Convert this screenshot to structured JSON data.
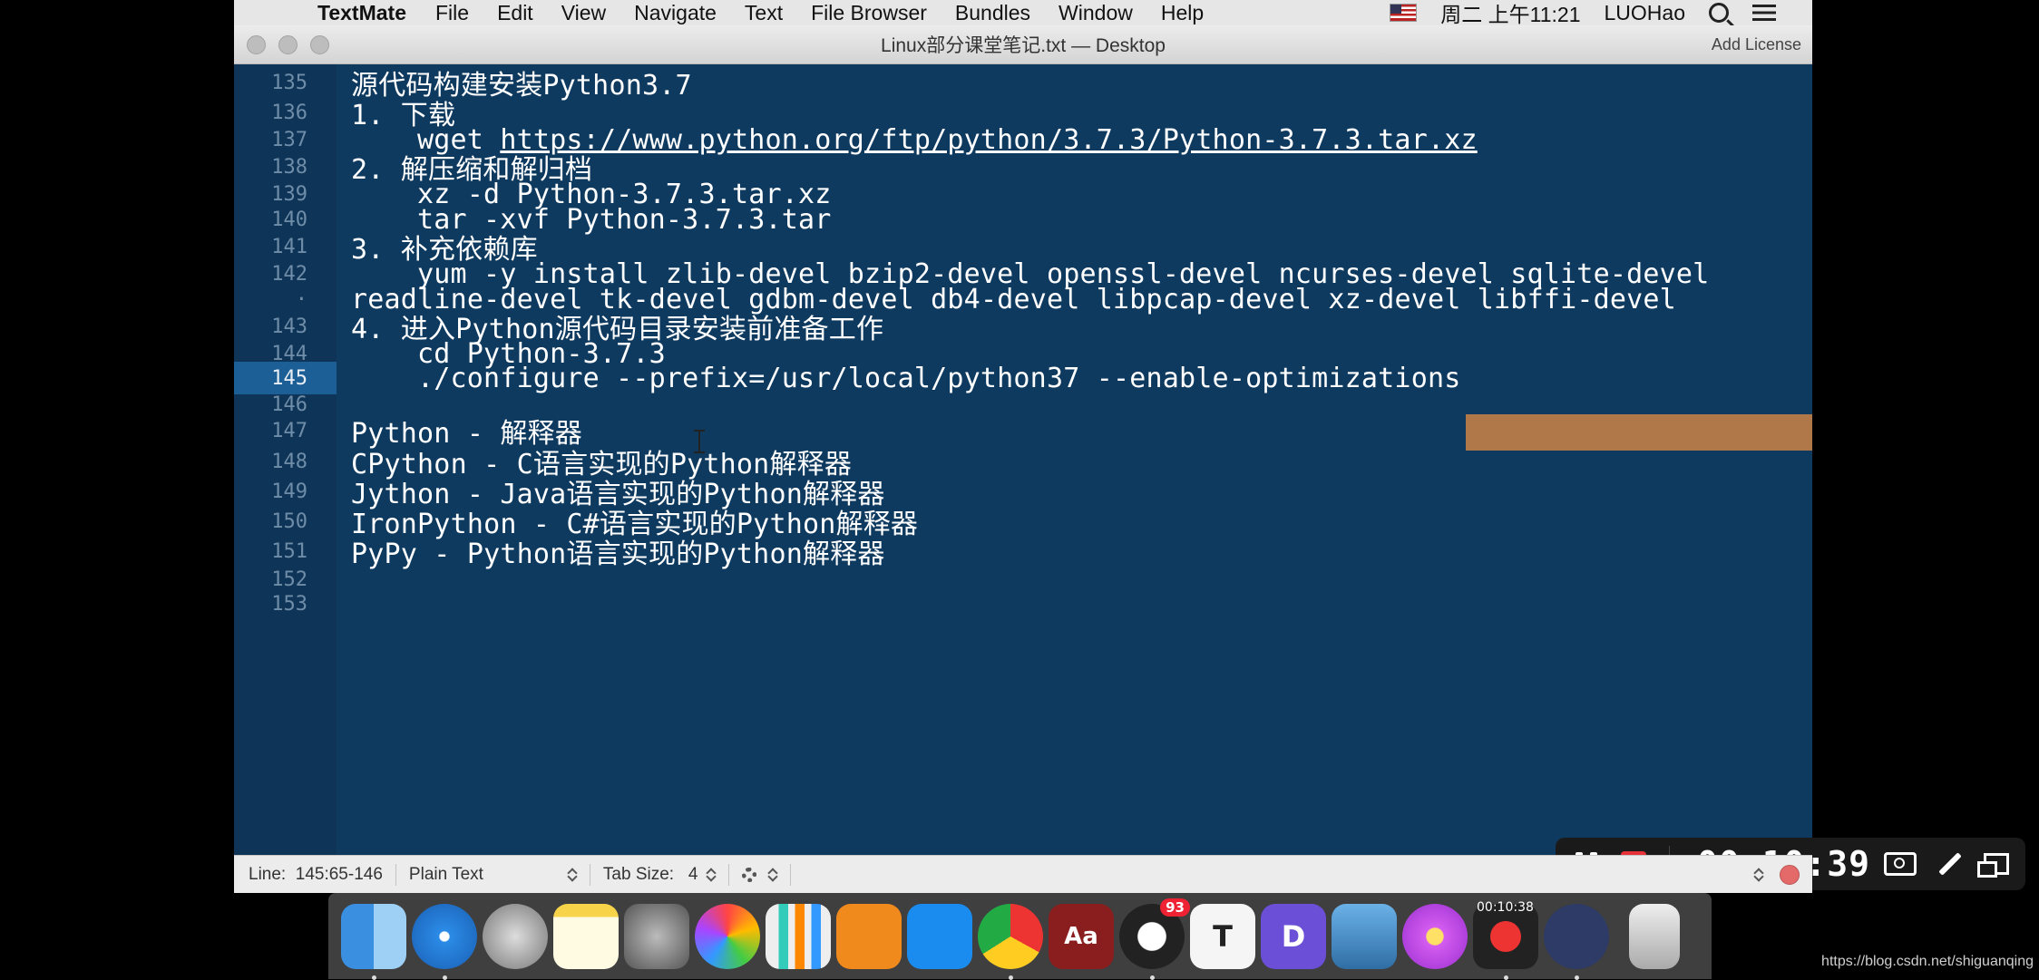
{
  "menubar": {
    "app_name": "TextMate",
    "items": [
      "File",
      "Edit",
      "View",
      "Navigate",
      "Text",
      "File Browser",
      "Bundles",
      "Window",
      "Help"
    ],
    "clock": "周二 上午11:21",
    "user": "LUOHao"
  },
  "window": {
    "title": "Linux部分课堂笔记.txt — Desktop",
    "add_license": "Add License"
  },
  "editor": {
    "lines": [
      {
        "num": "135",
        "text": "源代码构建安装Python3.7"
      },
      {
        "num": "136",
        "text": "1. 下载"
      },
      {
        "num": "137",
        "text": "wget ",
        "link": "https://www.python.org/ftp/python/3.7.3/Python-3.7.3.tar.xz"
      },
      {
        "num": "138",
        "text": "2. 解压缩和解归档"
      },
      {
        "num": "139",
        "text": "xz -d Python-3.7.3.tar.xz"
      },
      {
        "num": "140",
        "text": "tar -xvf Python-3.7.3.tar"
      },
      {
        "num": "141",
        "text": "3. 补充依赖库"
      },
      {
        "num": "142",
        "text": "yum -y install zlib-devel bzip2-devel openssl-devel ncurses-devel sqlite-devel"
      },
      {
        "num": "·",
        "text": "readline-devel tk-devel gdbm-devel db4-devel libpcap-devel xz-devel libffi-devel"
      },
      {
        "num": "143",
        "text": "4. 进入Python源代码目录安装前准备工作"
      },
      {
        "num": "144",
        "text": "cd Python-3.7.3"
      },
      {
        "num": "145",
        "text": "./configure --prefix=/usr/local/python37 --enable-optimizations"
      },
      {
        "num": "146",
        "text": ""
      },
      {
        "num": "147",
        "text": "Python - 解释器"
      },
      {
        "num": "148",
        "text": "CPython - C语言实现的Python解释器"
      },
      {
        "num": "149",
        "text": "Jython - Java语言实现的Python解释器"
      },
      {
        "num": "150",
        "text": "IronPython - C#语言实现的Python解释器"
      },
      {
        "num": "151",
        "text": "PyPy - Python语言实现的Python解释器"
      },
      {
        "num": "152",
        "text": ""
      },
      {
        "num": "153",
        "text": ""
      }
    ]
  },
  "recorder": {
    "time": "00:10:39"
  },
  "statusbar": {
    "line_label": "Line:",
    "line_value": "145:65-146",
    "grammar": "Plain Text",
    "tab_label": "Tab Size:",
    "tab_value": "4"
  },
  "dock": {
    "qq_badge": "93",
    "recorder_label": "00:10:38"
  },
  "watermark": "https://blog.csdn.net/shiguanqing"
}
